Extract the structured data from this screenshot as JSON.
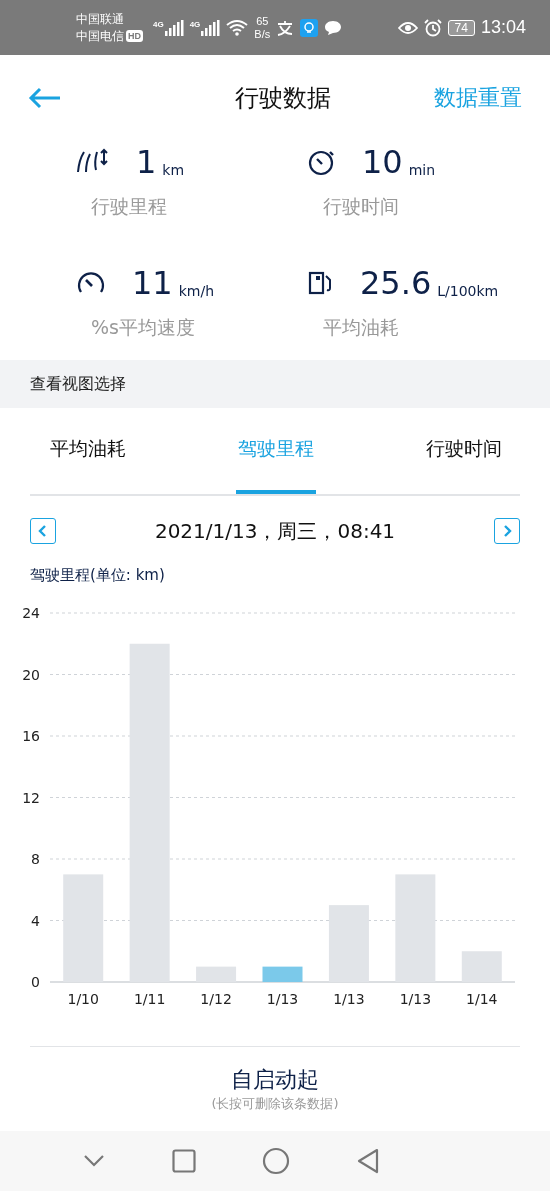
{
  "status_bar": {
    "carriers": [
      "中国联通",
      "中国电信"
    ],
    "hd": "HD",
    "networks": [
      "4G",
      "4G"
    ],
    "speed": [
      "65",
      "B/s"
    ],
    "battery": "74",
    "time": "13:04"
  },
  "header": {
    "title": "行驶数据",
    "action": "数据重置"
  },
  "stats": [
    {
      "kind": "distance",
      "value": "1",
      "unit": "km",
      "label": "行驶里程"
    },
    {
      "kind": "time",
      "value": "10",
      "unit": "min",
      "label": "行驶时间"
    },
    {
      "kind": "speed",
      "value": "11",
      "unit": "km/h",
      "label": "%s平均速度"
    },
    {
      "kind": "fuel",
      "value": "25.6",
      "unit": "L/100km",
      "label": "平均油耗"
    }
  ],
  "section_title": "查看视图选择",
  "tabs": [
    {
      "label": "平均油耗",
      "selected": false
    },
    {
      "label": "驾驶里程",
      "selected": true
    },
    {
      "label": "行驶时间",
      "selected": false
    }
  ],
  "date": "2021/1/13，周三，08:41",
  "chart": {
    "bars": [
      {
        "selected": false
      },
      {
        "selected": false
      },
      {
        "selected": false
      },
      {
        "selected": true
      },
      {
        "selected": false
      },
      {
        "selected": false
      },
      {
        "selected": false
      }
    ],
    "chart_data": {
      "type": "bar",
      "ylabel": "驾驶里程(单位: km)",
      "categories": [
        "1/10",
        "1/11",
        "1/12",
        "1/13",
        "1/13",
        "1/13",
        "1/14"
      ],
      "values": [
        7,
        22,
        1,
        1,
        5,
        7,
        2
      ],
      "ylim": [
        0,
        24
      ],
      "grid": true,
      "yticks": [
        0,
        4,
        8,
        12,
        16,
        20,
        24
      ]
    }
  },
  "trip": {
    "title": "自启动起",
    "hint": "(长按可删除该条数据)"
  }
}
